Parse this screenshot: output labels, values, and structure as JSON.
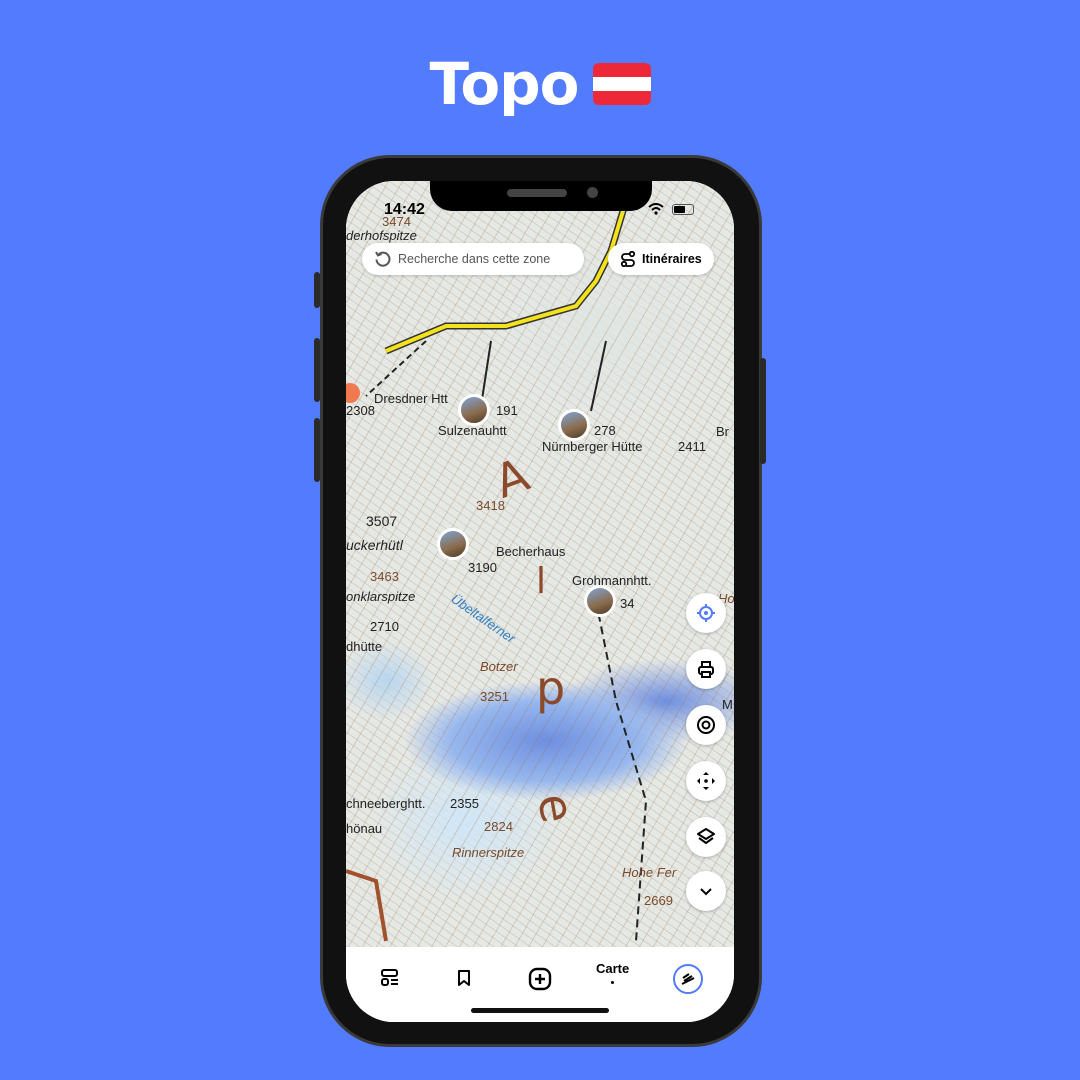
{
  "title": {
    "text": "Topo",
    "flag": "austria-flag",
    "flag_colors": [
      "#ed2939",
      "#ffffff",
      "#ed2939"
    ]
  },
  "status_bar": {
    "time": "14:42"
  },
  "search_zone_label": "Recherche dans cette zone",
  "itineraries_label": "Itinéraires",
  "map_labels": [
    "3474",
    "derhofspitze",
    "Dresdner Htt",
    "2308",
    "Sulzenauhtt",
    "191",
    "Nürnberger Hütte",
    "278",
    "2411",
    "Br",
    "3418",
    "3507",
    "uckerhütl",
    "Becherhaus",
    "3190",
    "Grohmannhtt.",
    "34",
    "3463",
    "onklarspitze",
    "Übeltalferner",
    "2710",
    "dhütte",
    "Botzer",
    "3251",
    "chneeberghtt.",
    "2355",
    "hönau",
    "2824",
    "Rinnerspitze",
    "Hohe Fer",
    "2669",
    "A",
    "l",
    "p",
    "e",
    "M",
    "Ho"
  ],
  "map_controls": [
    "locate-icon",
    "print-icon",
    "target-icon",
    "move-icon",
    "layers-icon",
    "chevron-down-icon"
  ],
  "tabbar": {
    "active_label": "Carte",
    "accent": "#527bfd"
  }
}
